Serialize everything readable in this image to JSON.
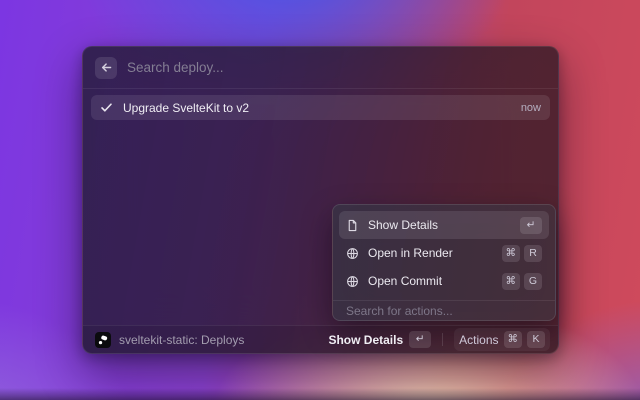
{
  "window": {
    "search": {
      "placeholder": "Search deploy..."
    },
    "result": {
      "label": "Upgrade SvelteKit to v2",
      "time": "now"
    },
    "actions_menu": {
      "items": [
        {
          "label": "Show Details",
          "icon": "document-icon",
          "keys": [
            "↵"
          ],
          "selected": true
        },
        {
          "label": "Open in Render",
          "icon": "globe-icon",
          "keys": [
            "⌘",
            "R"
          ],
          "selected": false
        },
        {
          "label": "Open Commit",
          "icon": "globe-icon",
          "keys": [
            "⌘",
            "G"
          ],
          "selected": false
        }
      ],
      "search_placeholder": "Search for actions..."
    },
    "status_bar": {
      "app_label": "sveltekit-static: Deploys",
      "primary_action": "Show Details",
      "primary_key": "↵",
      "secondary_action": "Actions",
      "secondary_keys": [
        "⌘",
        "K"
      ]
    }
  },
  "colors": {
    "bg_purple": "#7c36e2",
    "bg_blue": "#4258e9",
    "bg_red": "#cf4a5c",
    "bg_cream": "#f3e2c2",
    "modal_bg": "#28203a",
    "row_highlight": "#ffffff17",
    "text_primary": "#f0eef4",
    "text_muted": "#847e93"
  }
}
